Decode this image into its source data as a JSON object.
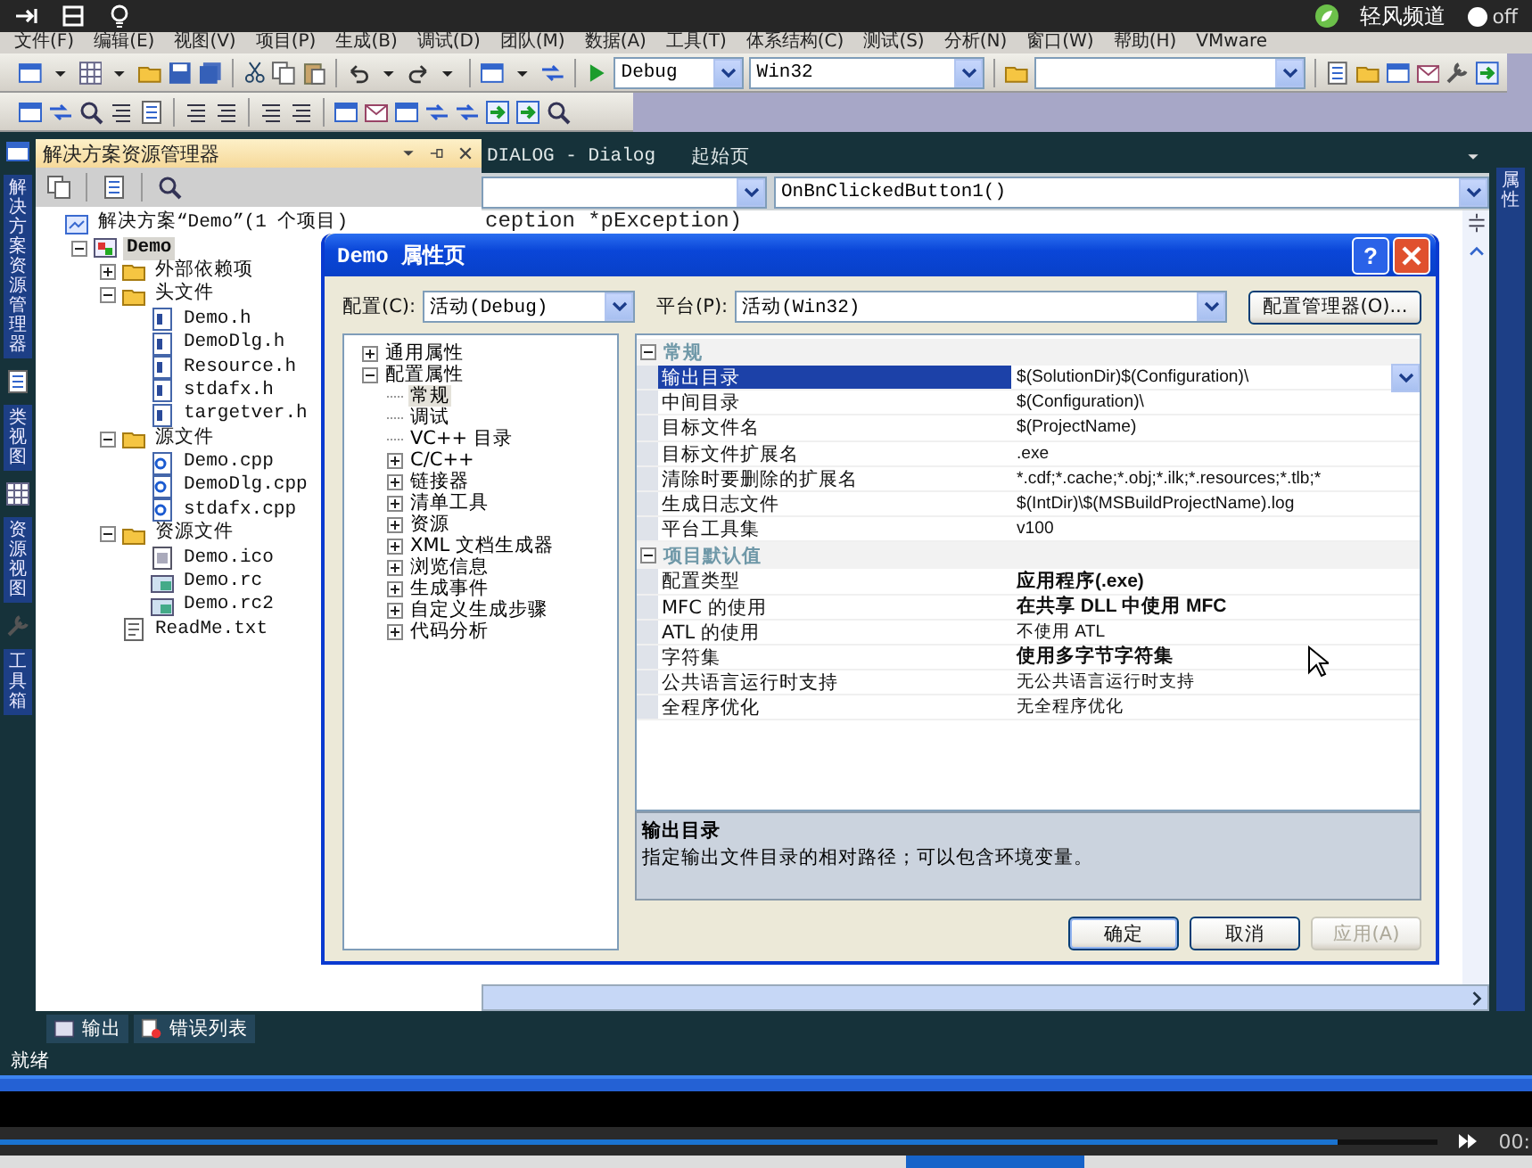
{
  "player": {
    "brand": "轻风频道",
    "toggle": {
      "label": "off",
      "on": false
    },
    "progress": {
      "level": 0.93
    },
    "time": "00:"
  },
  "menu": [
    "文件(F)",
    "编辑(E)",
    "视图(V)",
    "项目(P)",
    "生成(B)",
    "调试(D)",
    "团队(M)",
    "数据(A)",
    "工具(T)",
    "体系结构(C)",
    "测试(S)",
    "分析(N)",
    "窗口(W)",
    "帮助(H)",
    "VMware"
  ],
  "toolbar": {
    "configuration": "Debug",
    "platform": "Win32"
  },
  "side_tabs": [
    "解决方案资源管理器",
    "类视图",
    "资源视图",
    "工具箱"
  ],
  "solution_explorer": {
    "title": "解决方案资源管理器",
    "tree": [
      {
        "label": "解决方案“Demo”(1 个项目)",
        "kind": "solution",
        "selected": false,
        "children": [
          {
            "label": "Demo",
            "kind": "project",
            "expanded": true,
            "selected": true,
            "children": [
              {
                "label": "外部依赖项",
                "kind": "folder",
                "expanded": false,
                "selected": false
              },
              {
                "label": "头文件",
                "kind": "folder",
                "expanded": true,
                "selected": false,
                "children": [
                  {
                    "label": "Demo.h",
                    "kind": "header",
                    "selected": false
                  },
                  {
                    "label": "DemoDlg.h",
                    "kind": "header",
                    "selected": false
                  },
                  {
                    "label": "Resource.h",
                    "kind": "header",
                    "selected": false
                  },
                  {
                    "label": "stdafx.h",
                    "kind": "header",
                    "selected": false
                  },
                  {
                    "label": "targetver.h",
                    "kind": "header",
                    "selected": false
                  }
                ]
              },
              {
                "label": "源文件",
                "kind": "folder",
                "expanded": true,
                "selected": false,
                "children": [
                  {
                    "label": "Demo.cpp",
                    "kind": "source",
                    "selected": false
                  },
                  {
                    "label": "DemoDlg.cpp",
                    "kind": "source",
                    "selected": false
                  },
                  {
                    "label": "stdafx.cpp",
                    "kind": "source",
                    "selected": false
                  }
                ]
              },
              {
                "label": "资源文件",
                "kind": "folder",
                "expanded": true,
                "selected": false,
                "children": [
                  {
                    "label": "Demo.ico",
                    "kind": "image",
                    "selected": false
                  },
                  {
                    "label": "Demo.rc",
                    "kind": "resource",
                    "selected": false
                  },
                  {
                    "label": "Demo.rc2",
                    "kind": "resource",
                    "selected": false
                  }
                ]
              },
              {
                "label": "ReadMe.txt",
                "kind": "text",
                "selected": false
              }
            ]
          }
        ]
      }
    ]
  },
  "editor": {
    "tabs": [
      "DIALOG - Dialog",
      "起始页"
    ],
    "member": "OnBnClickedButton1()",
    "code": [
      "ception *pException)"
    ]
  },
  "right_tabs": [
    "属性"
  ],
  "dialog": {
    "title": "Demo 属性页",
    "help": "?",
    "config_label": "配置(C):",
    "config_value": "活动(Debug)",
    "platform_label": "平台(P):",
    "platform_value": "活动(Win32)",
    "manager_button": "配置管理器(O)...",
    "tree": [
      {
        "label": "通用属性",
        "expanded": false,
        "selected": false
      },
      {
        "label": "配置属性",
        "expanded": true,
        "selected": false,
        "children": [
          {
            "label": "常规",
            "selected": true
          },
          {
            "label": "调试",
            "selected": false
          },
          {
            "label": "VC++ 目录",
            "selected": false
          },
          {
            "label": "C/C++",
            "expanded": false,
            "selected": false
          },
          {
            "label": "链接器",
            "expanded": false,
            "selected": false
          },
          {
            "label": "清单工具",
            "expanded": false,
            "selected": false
          },
          {
            "label": "资源",
            "expanded": false,
            "selected": false
          },
          {
            "label": "XML 文档生成器",
            "expanded": false,
            "selected": false
          },
          {
            "label": "浏览信息",
            "expanded": false,
            "selected": false
          },
          {
            "label": "生成事件",
            "expanded": false,
            "selected": false
          },
          {
            "label": "自定义生成步骤",
            "expanded": false,
            "selected": false
          },
          {
            "label": "代码分析",
            "expanded": false,
            "selected": false
          }
        ]
      }
    ],
    "grid": [
      {
        "category": "常规",
        "expanded": true,
        "rows": [
          {
            "name": "输出目录",
            "value": "$(SolutionDir)$(Configuration)\\",
            "selected": true,
            "bold": false
          },
          {
            "name": "中间目录",
            "value": "$(Configuration)\\",
            "selected": false,
            "bold": false
          },
          {
            "name": "目标文件名",
            "value": "$(ProjectName)",
            "selected": false,
            "bold": false
          },
          {
            "name": "目标文件扩展名",
            "value": ".exe",
            "selected": false,
            "bold": false
          },
          {
            "name": "清除时要删除的扩展名",
            "value": "*.cdf;*.cache;*.obj;*.ilk;*.resources;*.tlb;*",
            "selected": false,
            "bold": false
          },
          {
            "name": "生成日志文件",
            "value": "$(IntDir)\\$(MSBuildProjectName).log",
            "selected": false,
            "bold": false
          },
          {
            "name": "平台工具集",
            "value": "v100",
            "selected": false,
            "bold": false
          }
        ]
      },
      {
        "category": "项目默认值",
        "expanded": true,
        "rows": [
          {
            "name": "配置类型",
            "value": "应用程序(.exe)",
            "selected": false,
            "bold": true
          },
          {
            "name": "MFC 的使用",
            "value": "在共享 DLL 中使用 MFC",
            "selected": false,
            "bold": true
          },
          {
            "name": "ATL 的使用",
            "value": "不使用 ATL",
            "selected": false,
            "bold": false
          },
          {
            "name": "字符集",
            "value": "使用多字节字符集",
            "selected": false,
            "bold": true
          },
          {
            "name": "公共语言运行时支持",
            "value": "无公共语言运行时支持",
            "selected": false,
            "bold": false
          },
          {
            "name": "全程序优化",
            "value": "无全程序优化",
            "selected": false,
            "bold": false
          }
        ]
      }
    ],
    "description": {
      "title": "输出目录",
      "text": "指定输出文件目录的相对路径；可以包含环境变量。"
    },
    "buttons": [
      {
        "label": "确定",
        "default": true,
        "disabled": false
      },
      {
        "label": "取消",
        "default": false,
        "disabled": false
      },
      {
        "label": "应用(A)",
        "default": false,
        "disabled": true
      }
    ]
  },
  "bottom_tabs": [
    {
      "label": "输出",
      "kind": "output"
    },
    {
      "label": "错误列表",
      "kind": "errors"
    }
  ],
  "status": "就绪"
}
